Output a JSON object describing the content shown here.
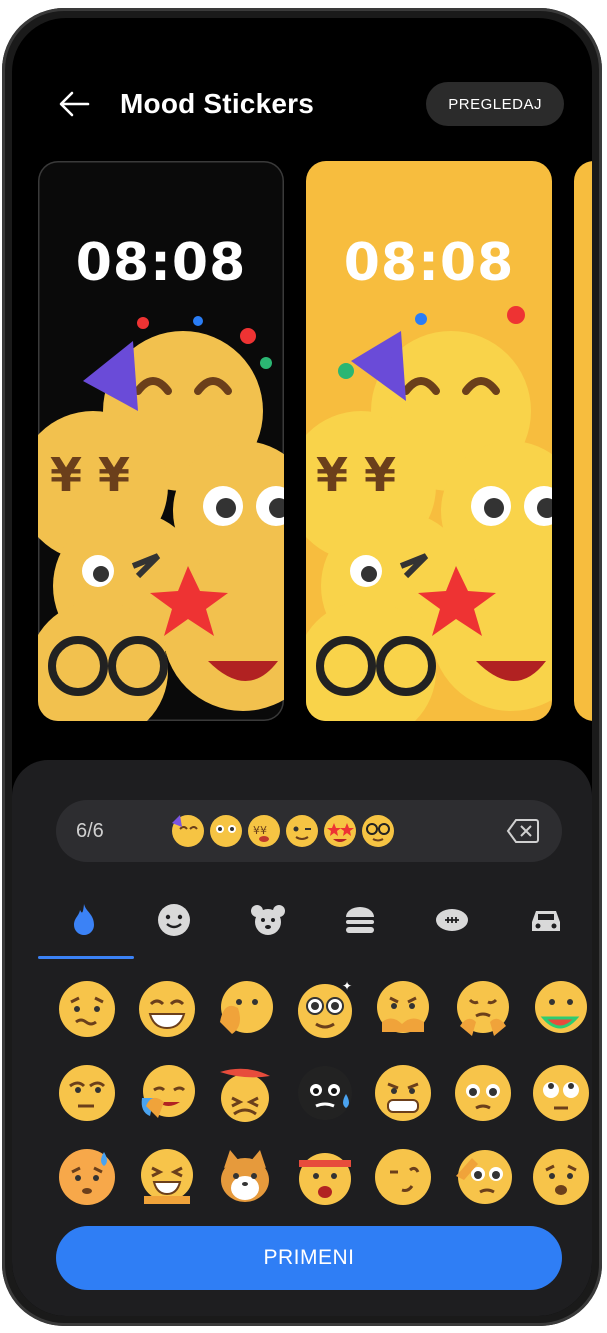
{
  "header": {
    "title": "Mood Stickers",
    "preview_label": "PREGLEDAJ"
  },
  "previews": [
    {
      "time": "08:08",
      "theme": "dark"
    },
    {
      "time": "08:08",
      "theme": "yellow"
    }
  ],
  "selection": {
    "count": "6/6",
    "emojis": [
      "party-face-icon",
      "flushed-face-icon",
      "money-face-icon",
      "wink-face-icon",
      "star-eyes-face-icon",
      "glasses-face-icon"
    ]
  },
  "tabs": [
    "fire-icon",
    "smiley-icon",
    "bear-icon",
    "burger-icon",
    "football-icon",
    "car-icon"
  ],
  "active_tab": "fire-icon",
  "footer": {
    "apply_label": "PRIMENI"
  },
  "colors": {
    "accent": "#2f7ef5",
    "card_yellow": "#f7bd3e",
    "panel_bg": "#1e1e20"
  }
}
